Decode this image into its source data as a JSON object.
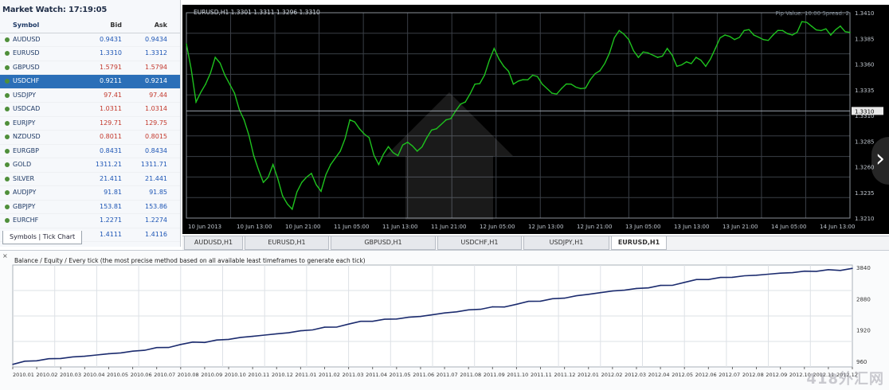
{
  "market_watch": {
    "title": "Market Watch: 17:19:05",
    "headers": {
      "symbol": "Symbol",
      "bid": "Bid",
      "ask": "Ask"
    },
    "rows": [
      {
        "symbol": "AUDUSD",
        "bid": "0.9431",
        "ask": "0.9434",
        "dir": "up"
      },
      {
        "symbol": "EURUSD",
        "bid": "1.3310",
        "ask": "1.3312",
        "dir": "up"
      },
      {
        "symbol": "GBPUSD",
        "bid": "1.5791",
        "ask": "1.5794",
        "dir": "dn"
      },
      {
        "symbol": "USDCHF",
        "bid": "0.9211",
        "ask": "0.9214",
        "dir": "up",
        "selected": true
      },
      {
        "symbol": "USDJPY",
        "bid": "97.41",
        "ask": "97.44",
        "dir": "dn"
      },
      {
        "symbol": "USDCAD",
        "bid": "1.0311",
        "ask": "1.0314",
        "dir": "dn"
      },
      {
        "symbol": "EURJPY",
        "bid": "129.71",
        "ask": "129.75",
        "dir": "dn"
      },
      {
        "symbol": "NZDUSD",
        "bid": "0.8011",
        "ask": "0.8015",
        "dir": "dn"
      },
      {
        "symbol": "EURGBP",
        "bid": "0.8431",
        "ask": "0.8434",
        "dir": "up"
      },
      {
        "symbol": "GOLD",
        "bid": "1311.21",
        "ask": "1311.71",
        "dir": "up"
      },
      {
        "symbol": "SILVER",
        "bid": "21.411",
        "ask": "21.441",
        "dir": "up"
      },
      {
        "symbol": "AUDJPY",
        "bid": "91.81",
        "ask": "91.85",
        "dir": "up"
      },
      {
        "symbol": "GBPJPY",
        "bid": "153.81",
        "ask": "153.86",
        "dir": "up"
      },
      {
        "symbol": "EURCHF",
        "bid": "1.2271",
        "ask": "1.2274",
        "dir": "up"
      },
      {
        "symbol": "EURAUD",
        "bid": "1.4111",
        "ask": "1.4116",
        "dir": "up"
      }
    ],
    "tabs": "Symbols | Tick Chart"
  },
  "price_chart": {
    "header": "EURUSD,H1  1.3301 1.3311 1.3296 1.3310",
    "info": "Pip Value: 10.00  Spread: 2",
    "axis_labels": [
      "1.3410",
      "1.3385",
      "1.3360",
      "1.3335",
      "1.3310",
      "1.3285",
      "1.3260",
      "1.3235",
      "1.3210"
    ],
    "current_price": "1.3310",
    "time_labels": [
      "10 Jun 2013",
      "10 Jun 13:00",
      "10 Jun 21:00",
      "11 Jun 05:00",
      "11 Jun 13:00",
      "11 Jun 21:00",
      "12 Jun 05:00",
      "12 Jun 13:00",
      "12 Jun 21:00",
      "13 Jun 05:00",
      "13 Jun 13:00",
      "13 Jun 21:00",
      "14 Jun 05:00",
      "14 Jun 13:00"
    ],
    "nav_arrow": "›"
  },
  "chart_tabs": [
    "AUDUSD,H1",
    "EURUSD,H1",
    "GBPUSD,H1",
    "USDCHF,H1",
    "USDJPY,H1",
    "EURUSD,H1"
  ],
  "chart_tabs_active": 5,
  "balance_graph": {
    "legend": "Balance / Equity / Every tick (the most precise method based on all available least timeframes to generate each tick)",
    "axis_labels": [
      "3840",
      "2880",
      "1920",
      "960"
    ],
    "time_labels": [
      "2010.01",
      "2010.02",
      "2010.03",
      "2010.04",
      "2010.05",
      "2010.06",
      "2010.07",
      "2010.08",
      "2010.09",
      "2010.10",
      "2010.11",
      "2010.12",
      "2011.01",
      "2011.02",
      "2011.03",
      "2011.04",
      "2011.05",
      "2011.06",
      "2011.07",
      "2011.08",
      "2011.09",
      "2011.10",
      "2011.11",
      "2011.12",
      "2012.01",
      "2012.02",
      "2012.03",
      "2012.04",
      "2012.05",
      "2012.06",
      "2012.07",
      "2012.08",
      "2012.09",
      "2012.10",
      "2012.11",
      "2012.12"
    ],
    "close_glyph": "×",
    "watermark": "418外汇网"
  },
  "colors": {
    "chart_bg": "#000000",
    "grid": "#3a3f46",
    "price_line": "#1ec21e",
    "balance_line": "#1b2b6e"
  },
  "chart_data": [
    {
      "type": "line",
      "series": [
        {
          "values": [
            1.3385,
            1.332,
            1.334,
            1.337,
            1.335,
            1.333,
            1.33,
            1.326,
            1.323,
            1.325,
            1.3215,
            1.32,
            1.323,
            1.324,
            1.322,
            1.325,
            1.3265,
            1.33,
            1.329,
            1.328,
            1.325,
            1.327,
            1.326,
            1.3275,
            1.3265,
            1.328,
            1.329,
            1.33,
            1.331,
            1.332,
            1.334,
            1.335,
            1.338,
            1.336,
            1.334,
            1.3345,
            1.335,
            1.334,
            1.333,
            1.3335,
            1.334,
            1.3335,
            1.3345,
            1.3355,
            1.3375,
            1.34,
            1.339,
            1.337,
            1.3375,
            1.337,
            1.338,
            1.336,
            1.3365,
            1.337,
            1.336,
            1.338,
            1.3395,
            1.339,
            1.34,
            1.3395,
            1.339,
            1.3395,
            1.34,
            1.3395,
            1.341,
            1.3405,
            1.34,
            1.3395,
            1.3405,
            1.3398
          ]
        }
      ],
      "ylim": [
        1.319,
        1.342
      ],
      "grid": true
    },
    {
      "type": "line",
      "series": [
        {
          "values": [
            100,
            240,
            330,
            420,
            520,
            620,
            760,
            880,
            960,
            1080,
            1200,
            1300,
            1420,
            1560,
            1680,
            1790,
            1880,
            1980,
            2120,
            2240,
            2360,
            2460,
            2580,
            2700,
            2850,
            2980,
            3080,
            3200,
            3320,
            3430,
            3520,
            3600,
            3680,
            3760,
            3820,
            3870
          ]
        }
      ],
      "ylim": [
        0,
        4000
      ],
      "grid": true
    }
  ]
}
